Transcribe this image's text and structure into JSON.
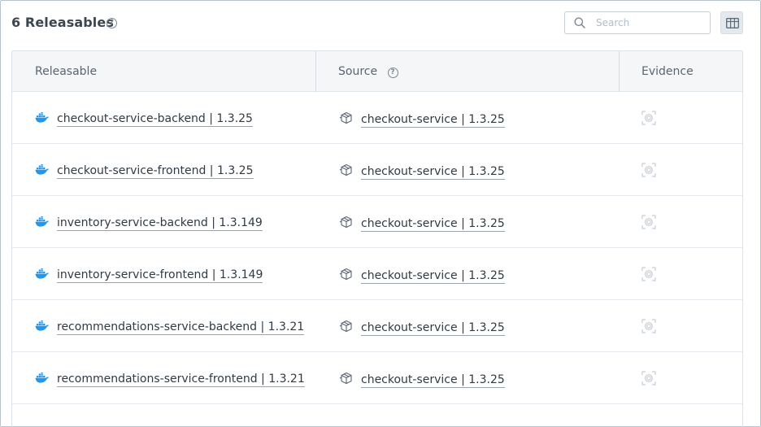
{
  "header": {
    "title": "6 Releasables",
    "search_placeholder": "Search"
  },
  "table": {
    "columns": [
      "Releasable",
      "Source",
      "Evidence"
    ],
    "rows": [
      {
        "releasable": "checkout-service-backend | 1.3.25",
        "source": "checkout-service | 1.3.25",
        "releasable_icon": "docker-icon",
        "source_icon": "package-icon",
        "evidence_icon": "evidence-icon"
      },
      {
        "releasable": "checkout-service-frontend | 1.3.25",
        "source": "checkout-service | 1.3.25",
        "releasable_icon": "docker-icon",
        "source_icon": "package-icon",
        "evidence_icon": "evidence-icon"
      },
      {
        "releasable": "inventory-service-backend | 1.3.149",
        "source": "checkout-service | 1.3.25",
        "releasable_icon": "docker-icon",
        "source_icon": "package-icon",
        "evidence_icon": "evidence-icon"
      },
      {
        "releasable": "inventory-service-frontend | 1.3.149",
        "source": "checkout-service | 1.3.25",
        "releasable_icon": "docker-icon",
        "source_icon": "package-icon",
        "evidence_icon": "evidence-icon"
      },
      {
        "releasable": "recommendations-service-backend | 1.3.21",
        "source": "checkout-service | 1.3.25",
        "releasable_icon": "docker-icon",
        "source_icon": "package-icon",
        "evidence_icon": "evidence-icon"
      },
      {
        "releasable": "recommendations-service-frontend | 1.3.21",
        "source": "checkout-service | 1.3.25",
        "releasable_icon": "docker-icon",
        "source_icon": "package-icon",
        "evidence_icon": "evidence-icon"
      }
    ]
  },
  "colors": {
    "docker_blue": "#2496ed",
    "border": "#dde3e8",
    "header_bg": "#f4f6f8"
  },
  "icons": {
    "title_help": "help-circle-icon",
    "source_help": "help-circle-icon",
    "search": "search-icon",
    "columns": "columns-icon"
  }
}
